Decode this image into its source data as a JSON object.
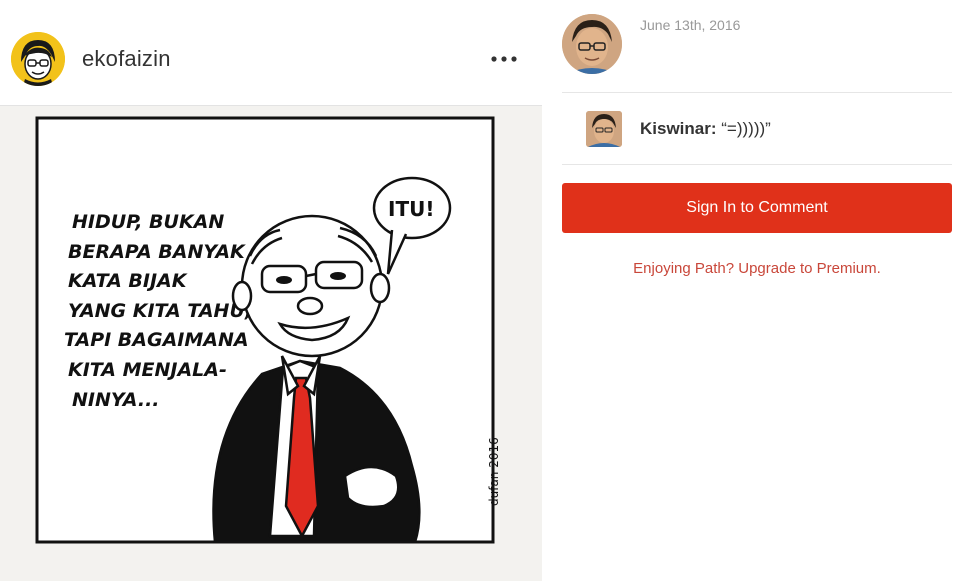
{
  "post": {
    "author_name": "ekofaizin",
    "more_icon": "more-horizontal-icon",
    "image": {
      "caption_lines": [
        "HIDUP, BUKAN",
        "BERAPA BANYAK",
        "KATA BIJAK",
        "YANG KITA TAHU,",
        "TAPI BAGAIMANA",
        "KITA MENJALA-",
        "NINYA..."
      ],
      "speech_bubble": "ITU!",
      "signature": "dufan 2016"
    }
  },
  "sidebar": {
    "date": "June 13th, 2016",
    "comment": {
      "author": "Kiswinar:",
      "text": "“=)))))”"
    },
    "signin_button": "Sign In to Comment",
    "premium_link": "Enjoying Path? Upgrade to Premium."
  },
  "colors": {
    "accent": "#e0311a",
    "link": "#c9473a",
    "avatar_ring": "#f2c21a"
  }
}
